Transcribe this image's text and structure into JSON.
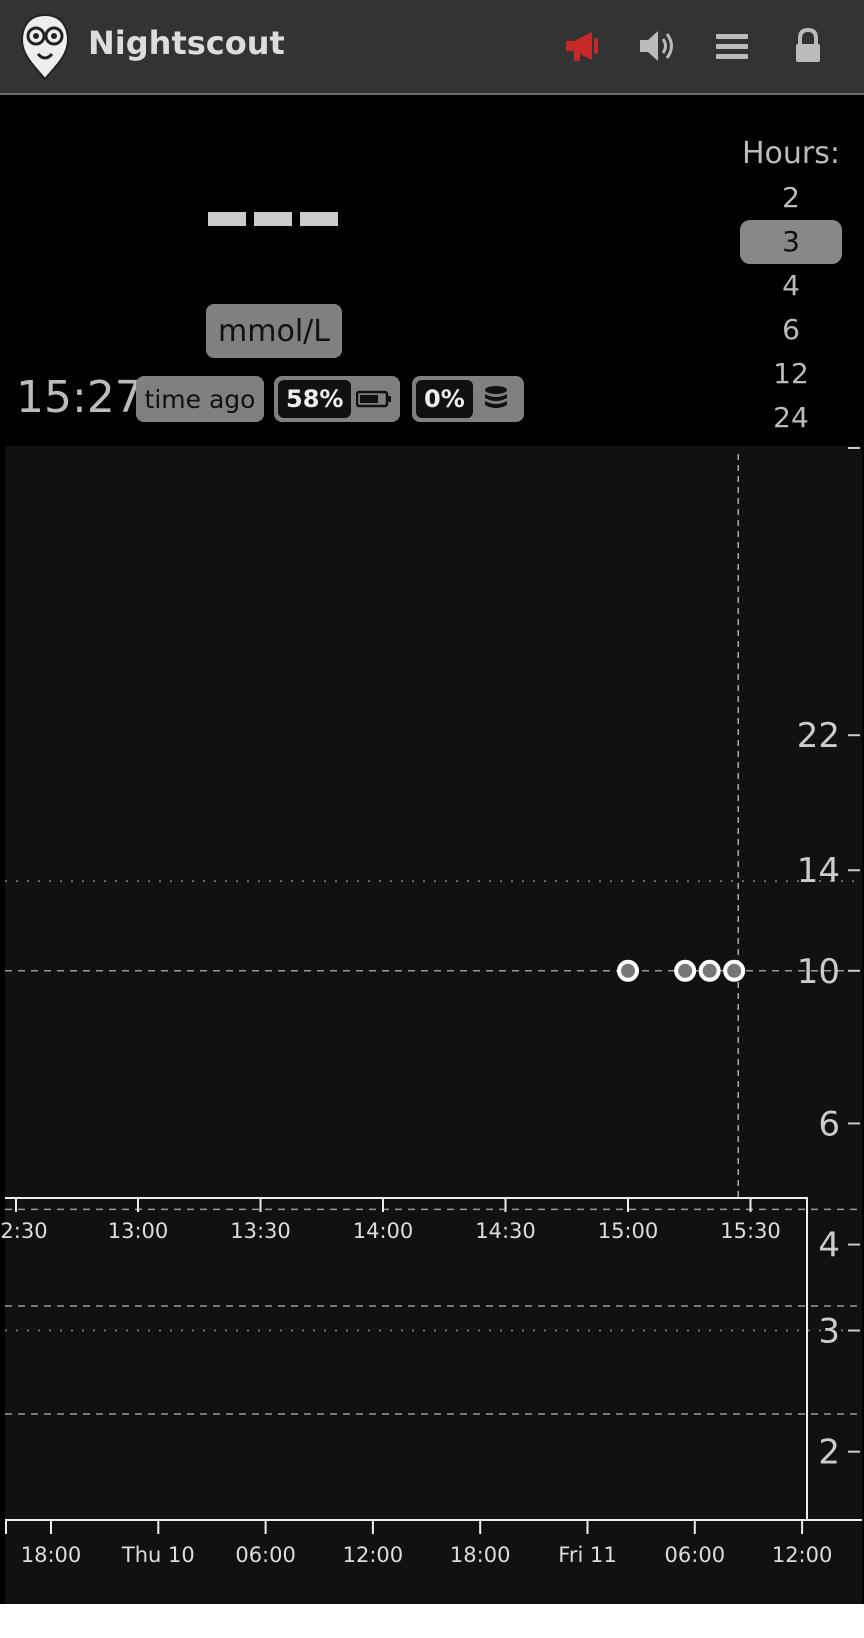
{
  "header": {
    "title": "Nightscout",
    "icons": [
      "nightscout-logo",
      "megaphone-icon",
      "speaker-icon",
      "menu-icon",
      "lock-icon"
    ],
    "alarm_color": "#c62828"
  },
  "status": {
    "bg_value": "---",
    "units": "mmol/L",
    "clock": "15:27",
    "time_ago": "time ago",
    "battery": "58%",
    "db_size": "0%"
  },
  "hours": {
    "label": "Hours:",
    "options": [
      "2",
      "3",
      "4",
      "6",
      "12",
      "24"
    ],
    "selected": "3"
  },
  "chart_data": [
    {
      "type": "scatter",
      "series": [
        {
          "points": [
            {
              "x": "15:00",
              "y": 10
            },
            {
              "x": "15:14",
              "y": 10
            },
            {
              "x": "15:20",
              "y": 10
            },
            {
              "x": "15:26",
              "y": 10
            }
          ]
        }
      ],
      "x_ticks": [
        "2:30",
        "13:00",
        "13:30",
        "14:00",
        "14:30",
        "15:00",
        "15:30"
      ],
      "y_ticks": [
        22,
        14,
        10,
        6,
        4,
        3,
        2
      ],
      "y_scale": "log",
      "now": "15:27",
      "reference_lines": {
        "dashed": [
          10,
          4.5
        ],
        "dotted": [
          13.5,
          3
        ]
      }
    },
    {
      "type": "line",
      "x_ticks": [
        "18:00",
        "Thu 10",
        "06:00",
        "12:00",
        "18:00",
        "Fri 11",
        "06:00",
        "12:00"
      ],
      "role": "history navigator"
    }
  ]
}
